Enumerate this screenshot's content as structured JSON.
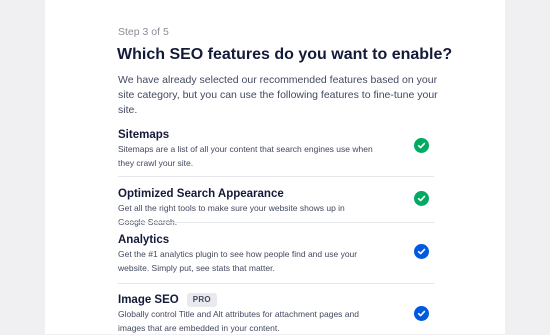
{
  "header": {
    "step": "Step 3 of 5",
    "title": "Which SEO features do you want to enable?",
    "description": "We have already selected our recommended features based on your site category, but you can use the following features to fine-tune your site."
  },
  "features": [
    {
      "name": "Sitemaps",
      "description": "Sitemaps are a list of all your content that search engines use when they crawl your site.",
      "checked": true,
      "color": "#00aa63"
    },
    {
      "name": "Optimized Search Appearance",
      "description": "Get all the right tools to make sure your website shows up in Google Search.",
      "checked": true,
      "color": "#00aa63"
    },
    {
      "name": "Analytics",
      "description": "Get the #1 analytics plugin to see how people find and use your website. Simply put, see stats that matter.",
      "checked": true,
      "color": "#005ae0"
    },
    {
      "name": "Image SEO",
      "badge": "PRO",
      "description": "Globally control Title and Alt attributes for attachment pages and images that are embedded in your content.",
      "checked": true,
      "color": "#005ae0"
    }
  ]
}
